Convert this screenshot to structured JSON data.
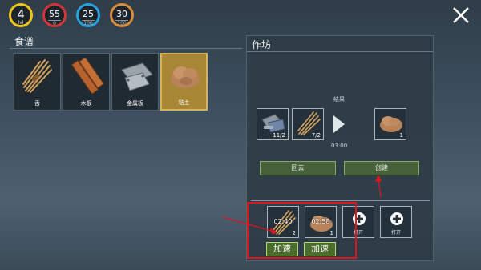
{
  "stats": {
    "level": {
      "value": "4",
      "sub": "lvl",
      "color": "#f0c419"
    },
    "health": {
      "value": "55",
      "sub": "0",
      "color": "#d23535"
    },
    "water": {
      "value": "25",
      "sub": "100",
      "color": "#2aa2e0"
    },
    "food": {
      "value": "30",
      "sub": "100",
      "color": "#d98c3a"
    }
  },
  "recipes": {
    "title": "食谱",
    "items": [
      {
        "label": "舌",
        "icon": "straw-icon"
      },
      {
        "label": "木板",
        "icon": "wooden-plank-icon"
      },
      {
        "label": "金属板",
        "icon": "metal-plate-icon"
      },
      {
        "label": "粘土",
        "icon": "clay-icon",
        "selected": true
      }
    ]
  },
  "workshop": {
    "title": "作坊",
    "result_label": "结果",
    "craft_time": "03:00",
    "inputs": [
      {
        "icon": "metal-scraps-icon",
        "count": "11/2"
      },
      {
        "icon": "straw-icon",
        "count": "7/2"
      }
    ],
    "output": {
      "icon": "clay-icon",
      "count": "1"
    },
    "back_label": "回去",
    "create_label": "创建",
    "queue": [
      {
        "icon": "straw-icon",
        "time": "02:40",
        "count": "2",
        "speed_label": "加速"
      },
      {
        "icon": "clay-icon",
        "time": "02:58",
        "count": "1",
        "speed_label": "加速"
      },
      {
        "icon": "add-slot-icon",
        "open_label": "打开"
      },
      {
        "icon": "add-slot-icon",
        "open_label": "打开"
      }
    ]
  },
  "colors": {
    "annotation": "#e3121b",
    "accent_green": "#46613a",
    "selected": "#a78635"
  }
}
